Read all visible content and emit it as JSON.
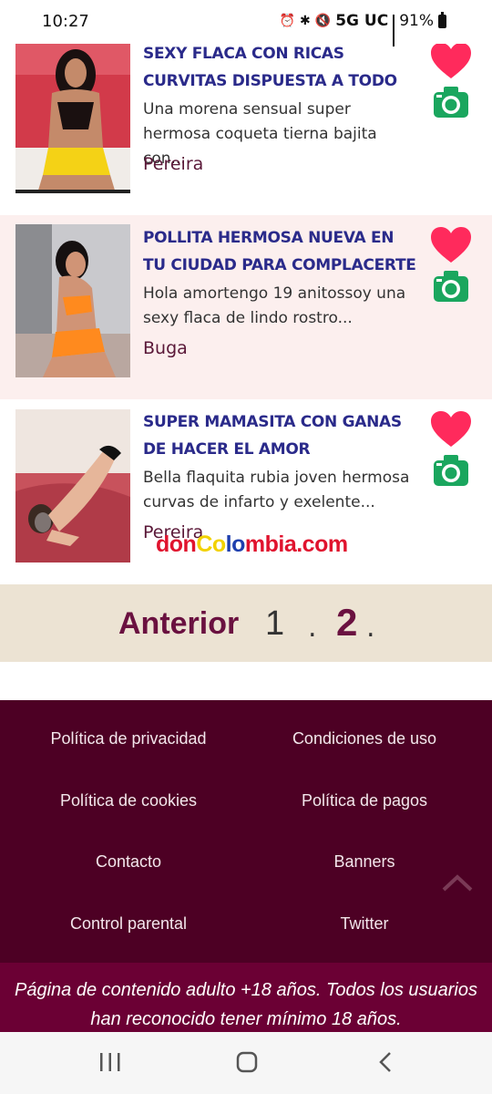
{
  "status_bar": {
    "time": "10:27",
    "network": "5G UC",
    "battery": "91%",
    "icons": [
      "alarm-icon",
      "bluetooth-icon",
      "mute-icon",
      "signal-icon",
      "battery-icon"
    ]
  },
  "listings": [
    {
      "title": "SEXY FLACA CON RICAS CURVITAS DISPUESTA A TODO",
      "description": "Una morena sensual super hermosa coqueta tierna bajita con...",
      "city": "Pereira"
    },
    {
      "title": "POLLITA HERMOSA NUEVA EN TU CIUDAD PARA COMPLACERTE",
      "description": "Hola amortengo 19 anitossoy una sexy flaca de lindo rostro...",
      "city": "Buga"
    },
    {
      "title": "SUPER MAMASITA CON GANAS DE HACER EL AMOR",
      "description": "Bella flaquita rubia joven hermosa curvas de infarto y exelente...",
      "city": "Pereira"
    }
  ],
  "watermark": {
    "part1": "don",
    "part2": "Co",
    "part3": "lo",
    "part4": "mbia.com"
  },
  "pagination": {
    "previous": "Anterior",
    "page1": "1",
    "sep1": ".",
    "page2": "2",
    "sep2": "."
  },
  "footer": {
    "links": [
      "Política de privacidad",
      "Condiciones de uso",
      "Política de cookies",
      "Política de pagos",
      "Contacto",
      "Banners",
      "Control parental",
      "Twitter"
    ],
    "notice": "Página de contenido adulto +18 años. Todos los usuarios han reconocido tener mínimo 18 años."
  },
  "colors": {
    "title": "#2a2a8a",
    "heart": "#ff2a5c",
    "camera": "#1aa65e",
    "footer": "#4d0024",
    "accent": "#6a1140"
  }
}
